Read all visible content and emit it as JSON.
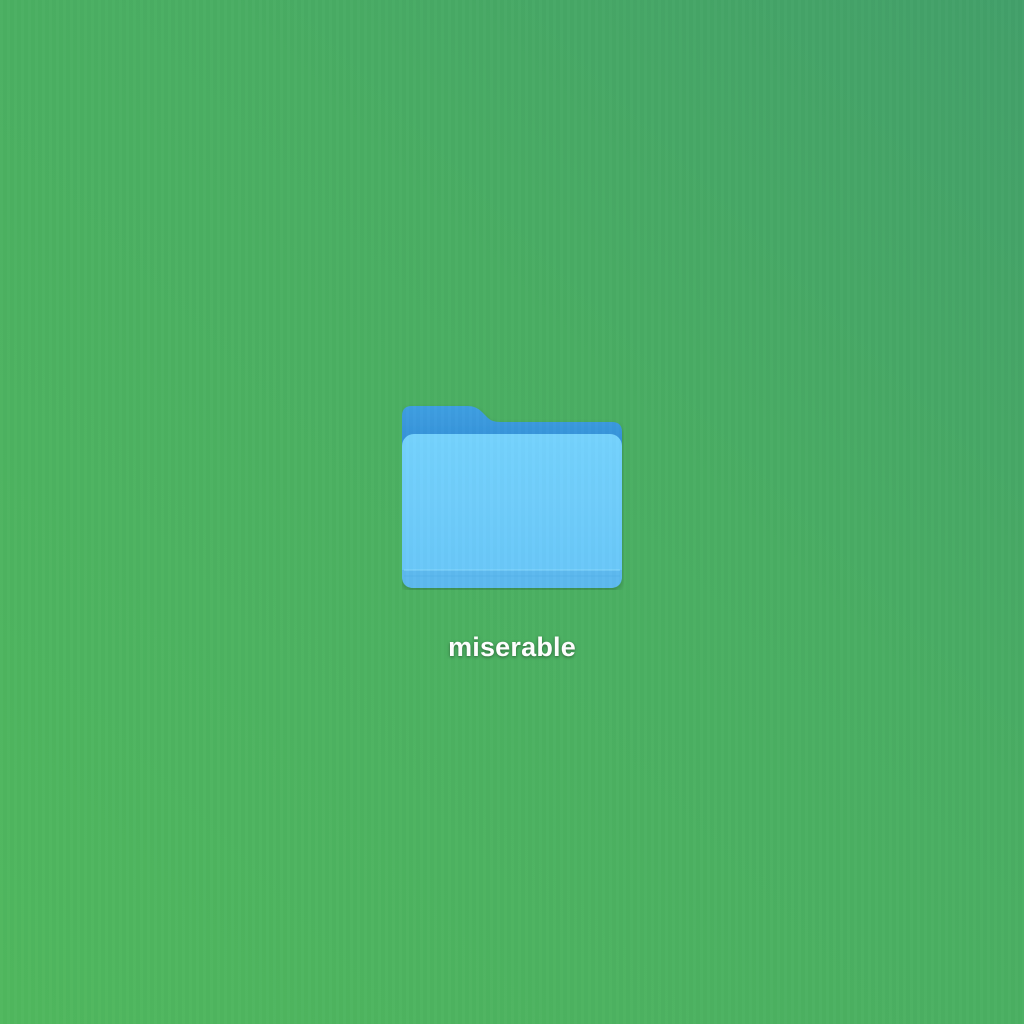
{
  "desktop": {
    "background_colors": [
      "#50b85e",
      "#43a06a"
    ],
    "items": [
      {
        "icon": "folder-icon",
        "label": "miserable",
        "icon_colors": {
          "front": "#6ecdfb",
          "back": "#3a9be0",
          "bottom_band": "#5cb8f0"
        }
      }
    ]
  }
}
